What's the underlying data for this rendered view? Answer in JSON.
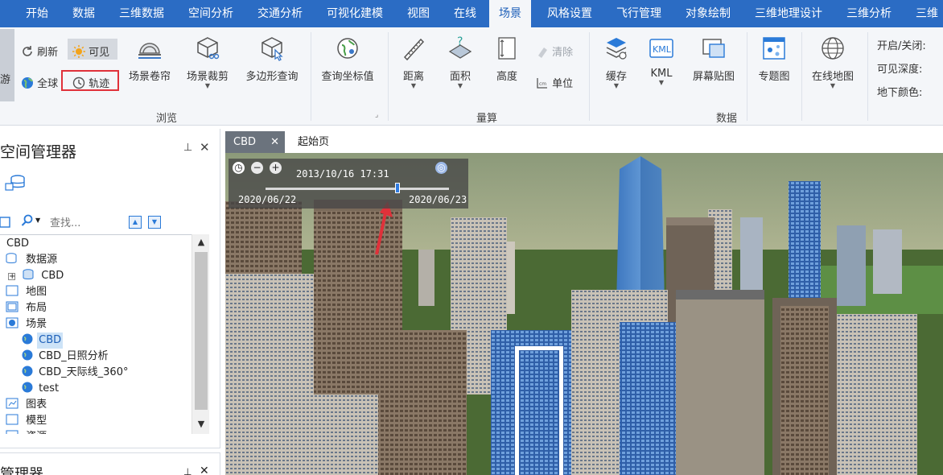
{
  "menu": {
    "tabs": [
      "开始",
      "数据",
      "三维数据",
      "空间分析",
      "交通分析",
      "可视化建模",
      "视图",
      "在线",
      "场景",
      "风格设置",
      "飞行管理",
      "对象绘制",
      "三维地理设计",
      "三维分析",
      "三维"
    ],
    "active": "场景"
  },
  "ribbon": {
    "browse": {
      "left_cut": "游",
      "refresh": "刷新",
      "visible": "可见",
      "global": "全球",
      "track": "轨迹",
      "scene_roller": "场景卷帘",
      "scene_clip": "场景裁剪",
      "polygon_query": "多边形查询",
      "query_coord": "查询坐标值",
      "label": "浏览"
    },
    "measure": {
      "distance": "距离",
      "area": "面积",
      "height": "高度",
      "clear": "清除",
      "unit": "单位",
      "label": "量算"
    },
    "data": {
      "cache": "缓存",
      "kml": "KML",
      "screen_tile": "屏幕贴图",
      "thematic": "专题图",
      "online_map": "在线地图",
      "label": "数据"
    },
    "ground": {
      "on_off": "开启/关闭:",
      "visible_depth": "可见深度:",
      "underground_color": "地下颜色:"
    }
  },
  "workspace": {
    "title": "空间管理器",
    "search_placeholder": "查找...",
    "tree": [
      "CBD",
      "数据源",
      "CBD",
      "地图",
      "布局",
      "场景",
      "CBD",
      "CBD_日照分析",
      "CBD_天际线_360°",
      "test",
      "图表",
      "模型",
      "资源"
    ],
    "bottom_title": "管理器"
  },
  "doc_tabs": [
    "CBD",
    "起始页"
  ],
  "timeline": {
    "current": "2013/10/16 17:31",
    "start": "2020/06/22",
    "end": "2020/06/23",
    "progress": 0.72
  },
  "colors": {
    "menu_bg": "#2b6cc4",
    "ribbon_bg": "#f4f6f9",
    "highlight": "#e0313a",
    "selection": "#cde3f7"
  }
}
